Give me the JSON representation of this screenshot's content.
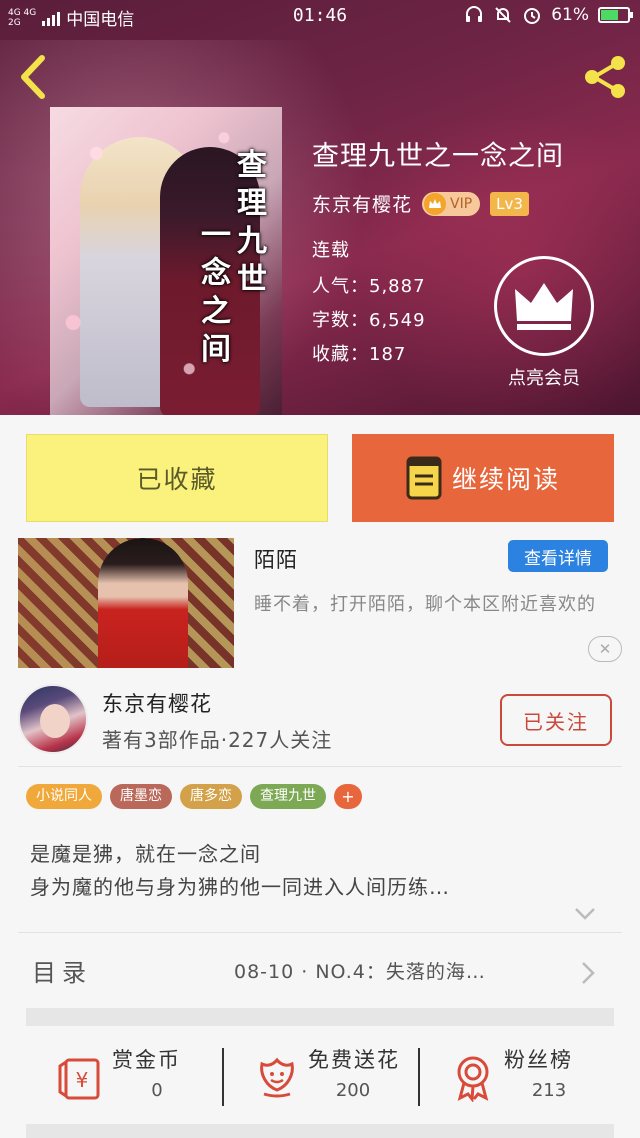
{
  "status_bar": {
    "network": "4G 4G",
    "network2": "2G",
    "carrier": "中国电信",
    "time": "01:46",
    "battery": "61%"
  },
  "book": {
    "title": "查理九世之一念之间",
    "cover_title_col1": "查理九世",
    "cover_title_col2": "一念之间",
    "author": "东京有樱花",
    "vip_label": "VIP",
    "level_label": "Lv3",
    "status": "连载",
    "popularity": "人气：5,887",
    "word_count": "字数：6,549",
    "favorites": "收藏：187",
    "vip_circle_label": "点亮会员"
  },
  "actions": {
    "favorited_label": "已收藏",
    "continue_label": "继续阅读"
  },
  "ad": {
    "name": "陌陌",
    "detail_button": "查看详情",
    "description": "睡不着，打开陌陌，聊个本区附近喜欢的"
  },
  "author_section": {
    "name": "东京有樱花",
    "stats": "著有3部作品·227人关注",
    "follow_label": "已关注"
  },
  "tags": [
    {
      "label": "小说同人",
      "color": "#f0a83a"
    },
    {
      "label": "唐墨恋",
      "color": "#b9685a"
    },
    {
      "label": "唐多恋",
      "color": "#d2a14a"
    },
    {
      "label": "查理九世",
      "color": "#7da955"
    }
  ],
  "tags_more": "+",
  "description": {
    "line1": "是魔是狒，就在一念之间",
    "line2": "身为魔的他与身为狒的他一同进入人间历练…"
  },
  "catalog": {
    "label": "目录",
    "latest": "08-10 · NO.4：失落的海…"
  },
  "stats": [
    {
      "label": "赏金币",
      "value": "0",
      "icon": "red-envelope-icon"
    },
    {
      "label": "免费送花",
      "value": "200",
      "icon": "flower-icon"
    },
    {
      "label": "粉丝榜",
      "value": "213",
      "icon": "medal-icon"
    }
  ],
  "colors": {
    "accent_orange": "#e8663c",
    "favorite_yellow": "#faf27c",
    "detail_blue": "#2b82e0",
    "follow_red": "#c94a3c",
    "icon_red": "#d84a3a"
  }
}
